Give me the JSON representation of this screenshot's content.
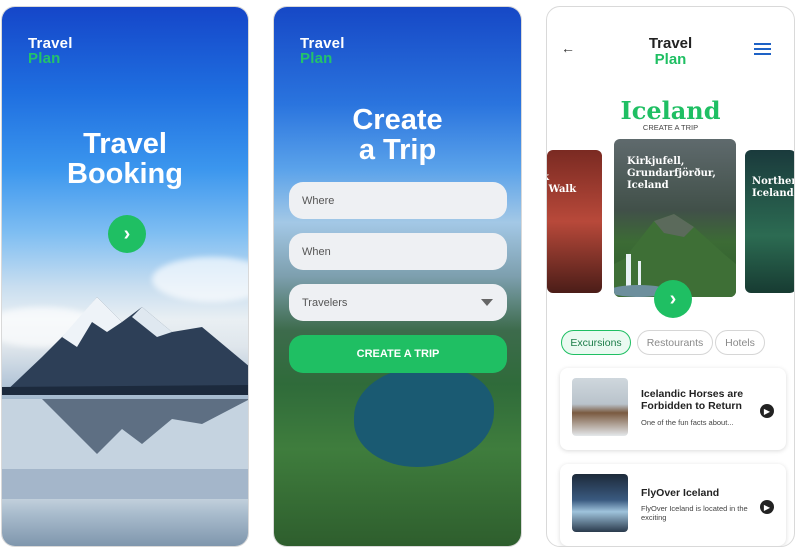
{
  "brand": {
    "line1": "Travel",
    "line2": "Plan",
    "accent": "#1fbf63"
  },
  "screen1": {
    "title_line1": "Travel",
    "title_line2": "Booking",
    "next_icon": "chevron-right-icon"
  },
  "screen2": {
    "title_line1": "Create",
    "title_line2": "a Trip",
    "fields": {
      "where": "Where",
      "when": "When",
      "travelers": "Travelers"
    },
    "cta": "CREATE A TRIP"
  },
  "screen3": {
    "country": "Iceland",
    "subtitle": "CREATE A TRIP",
    "cards": [
      {
        "title": "rik\nas Walk"
      },
      {
        "title": "Kirkjufell,\nGrundarfjörður,\nIceland"
      },
      {
        "title": "Norther\nIceland"
      }
    ],
    "tabs": [
      {
        "label": "Excursions",
        "active": true
      },
      {
        "label": "Restourants",
        "active": false
      },
      {
        "label": "Hotels",
        "active": false
      }
    ],
    "items": [
      {
        "title": "Icelandic Horses are Forbidden to Return",
        "desc": "One of the fun facts about..."
      },
      {
        "title": "FlyOver Iceland",
        "desc": "FlyOver Iceland is located in the exciting"
      }
    ]
  }
}
